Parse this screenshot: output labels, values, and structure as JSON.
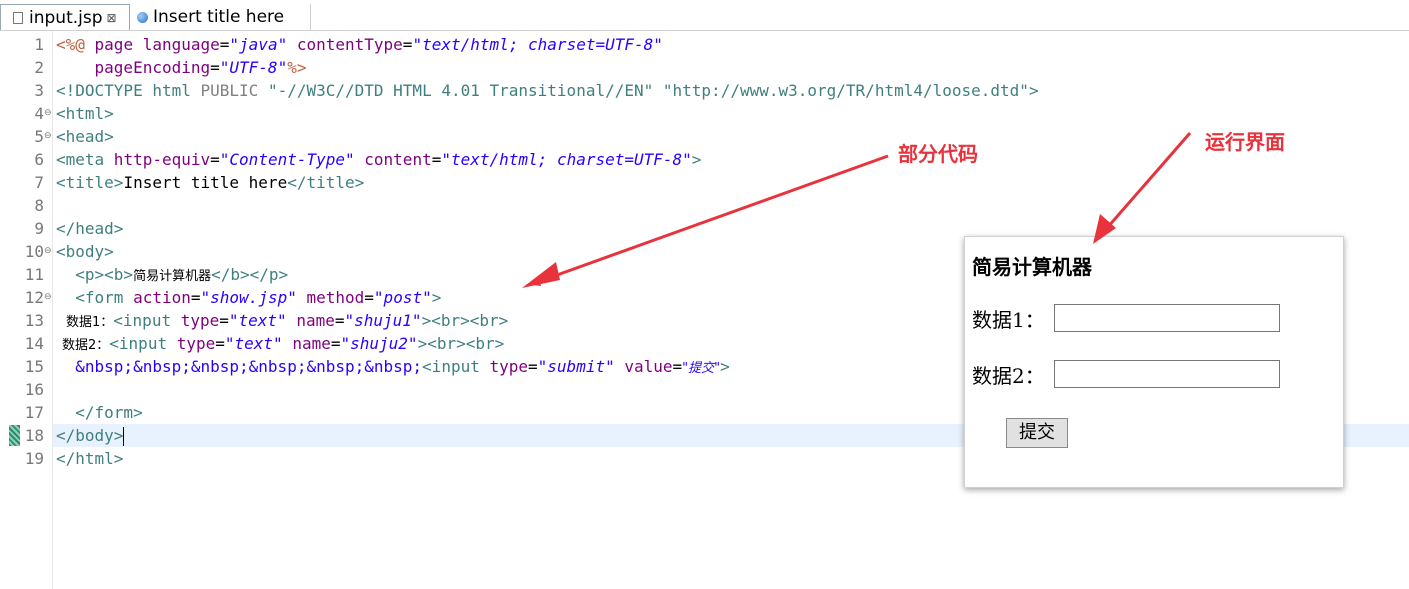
{
  "tabs": [
    {
      "label": "input.jsp",
      "close": "⊠",
      "active": true
    },
    {
      "label": "Insert title here",
      "active": false
    }
  ],
  "line_numbers": [
    "1",
    "2",
    "3",
    "4",
    "5",
    "6",
    "7",
    "8",
    "9",
    "10",
    "11",
    "12",
    "13",
    "14",
    "15",
    "16",
    "17",
    "18",
    "19"
  ],
  "code": {
    "l1": {
      "a": "<%@",
      "b": " page ",
      "c": "language",
      "d": "=",
      "e": "\"java\"",
      "f": " contentType",
      "g": "=",
      "h": "\"text/html; charset=UTF-8\""
    },
    "l2": {
      "a": "pageEncoding",
      "b": "=",
      "c": "\"UTF-8\"",
      "d": "%>"
    },
    "l3": {
      "a": "<!DOCTYPE",
      "b": " html ",
      "c": "PUBLIC ",
      "d": "\"-//W3C//DTD HTML 4.01 Transitional//EN\"",
      "e": " ",
      "f": "\"http://www.w3.org/TR/html4/loose.dtd\"",
      "g": ">"
    },
    "l4": "<html>",
    "l5": "<head>",
    "l6": {
      "a": "<meta",
      "b": " http-equiv",
      "c": "=",
      "d": "\"Content-Type\"",
      "e": " content",
      "f": "=",
      "g": "\"text/html; charset=UTF-8\"",
      "h": ">"
    },
    "l7": {
      "a": "<title>",
      "b": "Insert title here",
      "c": "</title>"
    },
    "l9": "</head>",
    "l10": "<body>",
    "l11": {
      "a": "<p><b>",
      "b": "简易计算机器",
      "c": "</b></p>"
    },
    "l12": {
      "a": "<form",
      "b": " action",
      "c": "=",
      "d": "\"show.jsp\"",
      "e": " method",
      "f": "=",
      "g": "\"post\"",
      "h": ">"
    },
    "l13": {
      "a": "数据1：",
      "b": "<input",
      "c": " type",
      "d": "=",
      "e": "\"text\"",
      "f": " name",
      "g": "=",
      "h": "\"shuju1\"",
      "i": "><br><br>"
    },
    "l14": {
      "a": "数据2：",
      "b": "<input",
      "c": " type",
      "d": "=",
      "e": "\"text\"",
      "f": " name",
      "g": "=",
      "h": "\"shuju2\"",
      "i": "><br><br>"
    },
    "l15": {
      "a": "&nbsp;&nbsp;&nbsp;&nbsp;&nbsp;&nbsp;",
      "b": "<input",
      "c": " type",
      "d": "=",
      "e": "\"submit\"",
      "f": " value",
      "g": "=",
      "h": "\"提交\"",
      "i": ">"
    },
    "l17": "</form>",
    "l18": "</body>",
    "l19": "</html>"
  },
  "preview": {
    "title": "简易计算机器",
    "label1": "数据1：",
    "label2": "数据2：",
    "submit": "提交"
  },
  "annotations": {
    "partial_code": "部分代码",
    "run_ui": "运行界面"
  },
  "colors": {
    "tag": "#3f7f7f",
    "attribute": "#7f007f",
    "value": "#2a00ff",
    "annotation": "#e8323c",
    "current_line": "#e8f2fe"
  }
}
